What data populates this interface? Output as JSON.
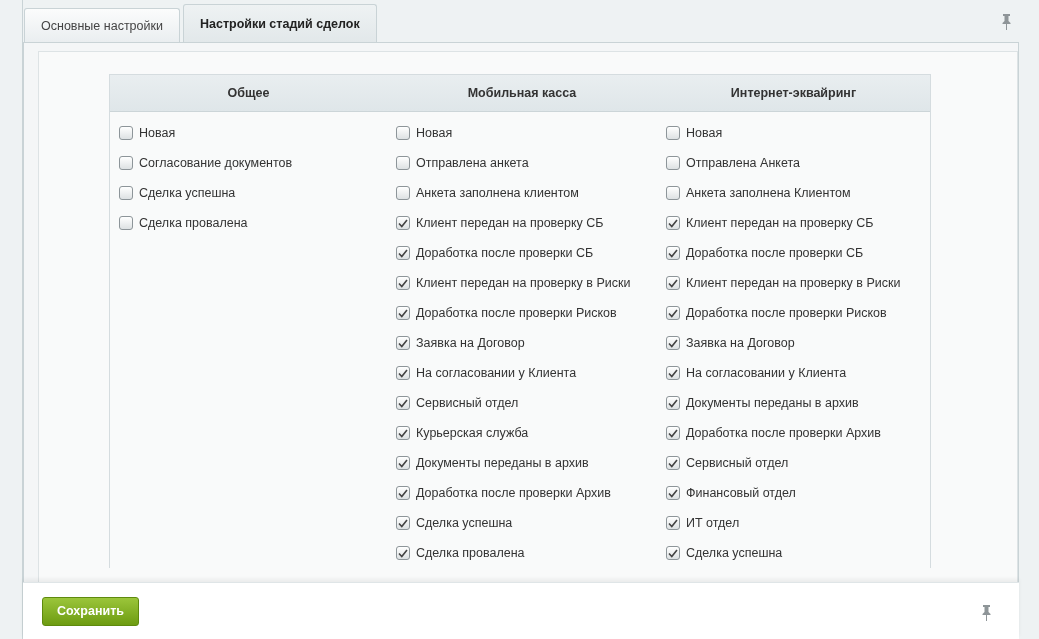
{
  "tabs": [
    {
      "label": "Основные настройки",
      "selected": false
    },
    {
      "label": "Настройки стадий сделок",
      "selected": true
    }
  ],
  "columns": [
    {
      "title": "Общее",
      "items": [
        {
          "label": "Новая",
          "checked": false
        },
        {
          "label": "Согласование документов",
          "checked": false
        },
        {
          "label": "Сделка успешна",
          "checked": false
        },
        {
          "label": "Сделка провалена",
          "checked": false
        }
      ]
    },
    {
      "title": "Мобильная касса",
      "items": [
        {
          "label": "Новая",
          "checked": false
        },
        {
          "label": "Отправлена анкета",
          "checked": false
        },
        {
          "label": "Анкета заполнена клиентом",
          "checked": false
        },
        {
          "label": "Клиент передан на проверку СБ",
          "checked": true
        },
        {
          "label": "Доработка после проверки СБ",
          "checked": true
        },
        {
          "label": "Клиент передан на проверку в Риски",
          "checked": true
        },
        {
          "label": "Доработка после проверки Рисков",
          "checked": true
        },
        {
          "label": "Заявка на Договор",
          "checked": true
        },
        {
          "label": "На согласовании у Клиента",
          "checked": true
        },
        {
          "label": "Сервисный отдел",
          "checked": true
        },
        {
          "label": "Курьерская служба",
          "checked": true
        },
        {
          "label": "Документы переданы в архив",
          "checked": true
        },
        {
          "label": "Доработка после проверки Архив",
          "checked": true
        },
        {
          "label": "Сделка успешна",
          "checked": true
        },
        {
          "label": "Сделка провалена",
          "checked": true
        }
      ]
    },
    {
      "title": "Интернет-эквайринг",
      "items": [
        {
          "label": "Новая",
          "checked": false
        },
        {
          "label": "Отправлена Анкета",
          "checked": false
        },
        {
          "label": "Анкета заполнена Клиентом",
          "checked": false
        },
        {
          "label": "Клиент передан на проверку СБ",
          "checked": true
        },
        {
          "label": "Доработка после проверки СБ",
          "checked": true
        },
        {
          "label": "Клиент передан на проверку в Риски",
          "checked": true
        },
        {
          "label": "Доработка после проверки Рисков",
          "checked": true
        },
        {
          "label": "Заявка на Договор",
          "checked": true
        },
        {
          "label": "На согласовании у Клиента",
          "checked": true
        },
        {
          "label": "Документы переданы в архив",
          "checked": true
        },
        {
          "label": "Доработка после проверки Архив",
          "checked": true
        },
        {
          "label": "Сервисный отдел",
          "checked": true
        },
        {
          "label": "Финансовый отдел",
          "checked": true
        },
        {
          "label": "ИТ отдел",
          "checked": true
        },
        {
          "label": "Сделка успешна",
          "checked": true
        }
      ]
    }
  ],
  "save_button": "Сохранить"
}
